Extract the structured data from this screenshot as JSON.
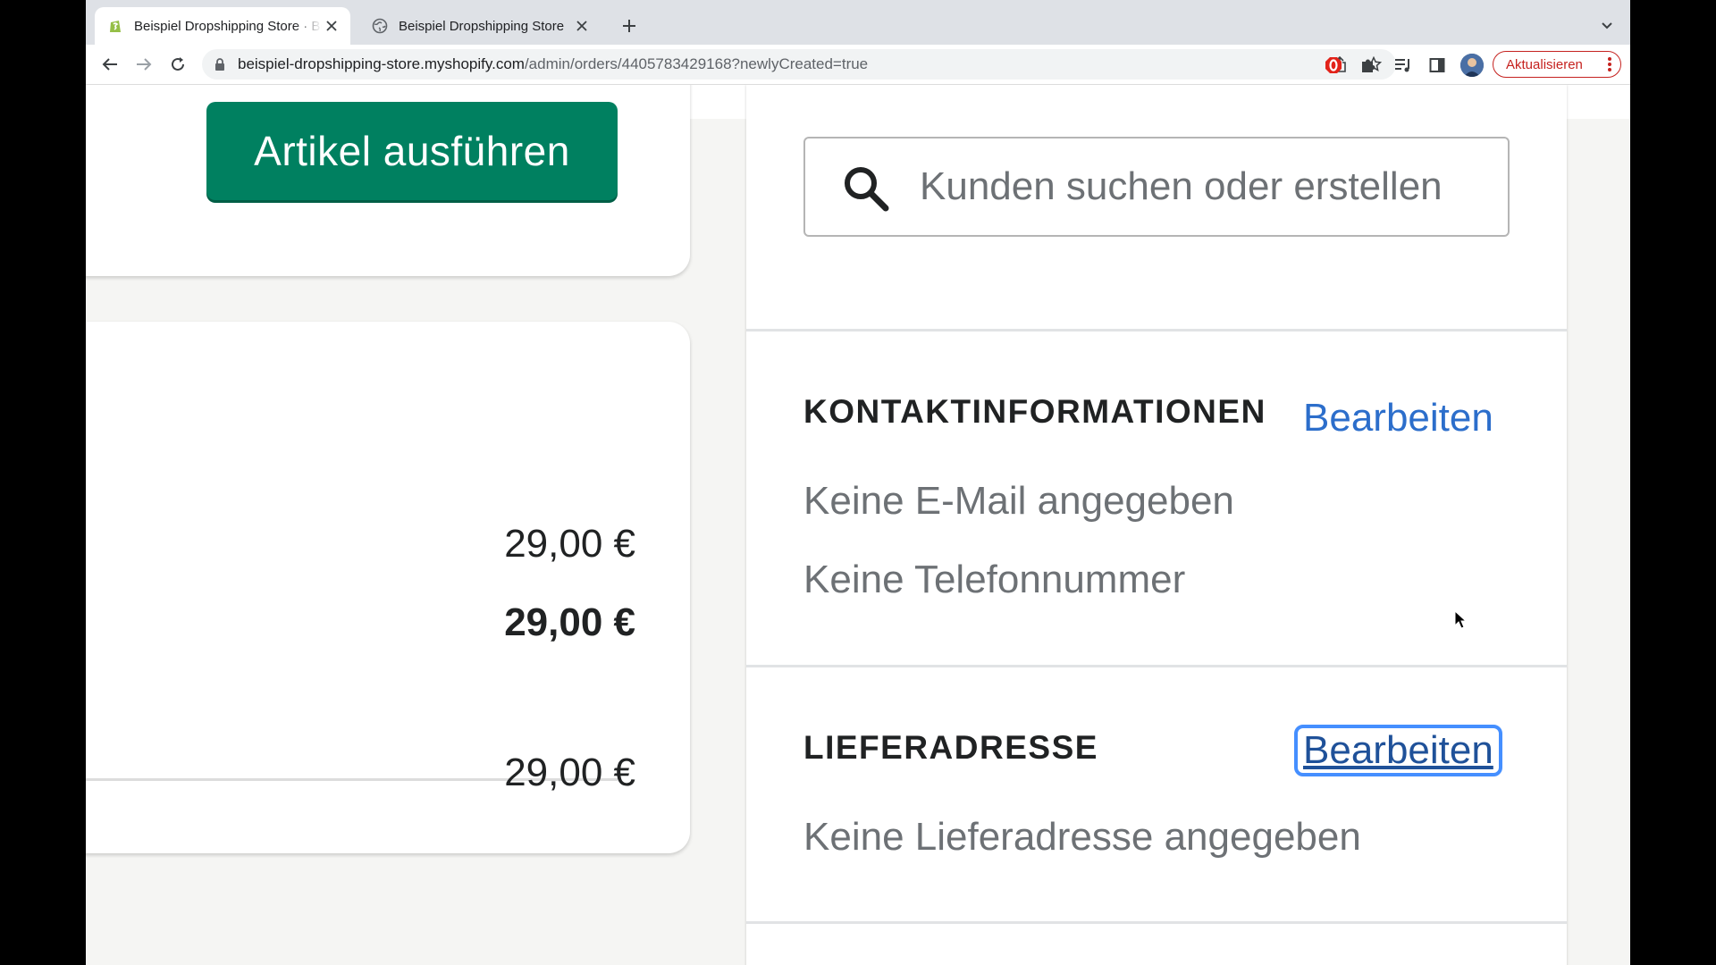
{
  "browser": {
    "tabs": [
      {
        "title": "Beispiel Dropshipping Store · Bestellungen",
        "active": true,
        "favicon": "shopify-icon"
      },
      {
        "title": "Beispiel Dropshipping Store",
        "active": false,
        "favicon": "globe-icon"
      }
    ],
    "url_host": "beispiel-dropshipping-store.myshopify.com",
    "url_path": "/admin/orders/4405783429168?newlyCreated=true",
    "update_label": "Aktualisieren",
    "accent_update": "#c5221f"
  },
  "order": {
    "fulfill_label": "Artikel ausführen",
    "subtotal": "29,00 €",
    "total": "29,00 €",
    "paid": "29,00 €"
  },
  "customer": {
    "search_placeholder": "Kunden suchen oder erstellen",
    "contact_heading": "KONTAKTINFORMATIONEN",
    "contact_edit": "Bearbeiten",
    "no_email": "Keine E-Mail angegeben",
    "no_phone": "Keine Telefonnummer",
    "shipping_heading": "LIEFERADRESSE",
    "shipping_edit": "Bearbeiten",
    "no_shipping": "Keine Lieferadresse angegeben"
  },
  "colors": {
    "primary_button": "#008060",
    "link": "#2c6ecb",
    "focus_ring": "#458fff"
  }
}
